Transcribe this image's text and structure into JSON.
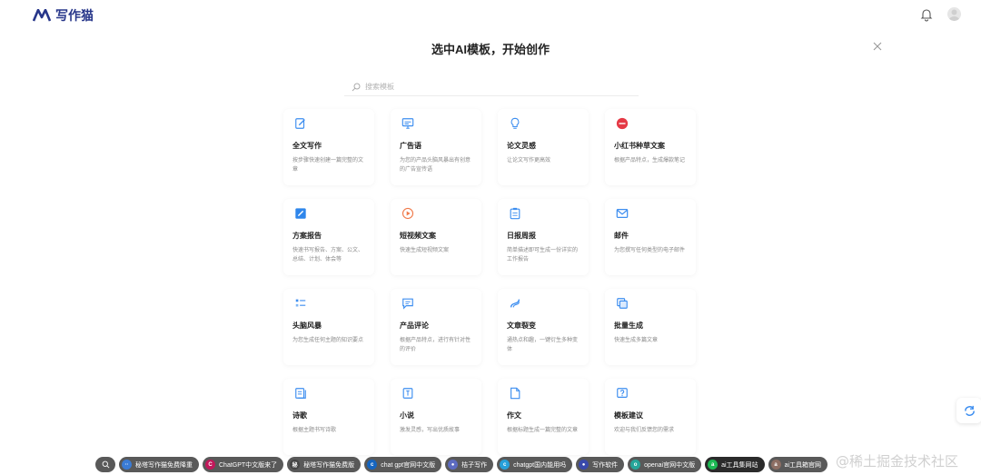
{
  "header": {
    "app_name": "写作猫"
  },
  "title": "选中AI模板，开始创作",
  "search": {
    "placeholder": "搜索模板"
  },
  "cards": [
    {
      "title": "全文写作",
      "desc": "按步骤快速创建一篇完整的文章",
      "icon": "edit-icon"
    },
    {
      "title": "广告语",
      "desc": "为您的产品头脑风暴出有创意的广告宣传语",
      "icon": "monitor-icon"
    },
    {
      "title": "论文灵感",
      "desc": "让论文写作更高效",
      "icon": "lightbulb-icon"
    },
    {
      "title": "小红书种草文案",
      "desc": "根据产品特点，生成爆款笔记",
      "icon": "xiaohongshu-icon"
    },
    {
      "title": "方案报告",
      "desc": "快速书写报告、方案、公文、总结、计划、体会等",
      "icon": "pen-icon"
    },
    {
      "title": "短视频文案",
      "desc": "快速生成短视频文案",
      "icon": "play-icon"
    },
    {
      "title": "日报周报",
      "desc": "简单描述即可生成一份详实的工作报告",
      "icon": "clipboard-icon"
    },
    {
      "title": "邮件",
      "desc": "为您撰写任何类型的电子邮件",
      "icon": "mail-icon"
    },
    {
      "title": "头脑风暴",
      "desc": "为您生成任何主题的知识要点",
      "icon": "list-icon"
    },
    {
      "title": "产品评论",
      "desc": "根据产品特点，进行有针对性的评价",
      "icon": "comment-icon"
    },
    {
      "title": "文章裂变",
      "desc": "通热点和趣，一键衍生多种变体",
      "icon": "split-icon"
    },
    {
      "title": "批量生成",
      "desc": "快速生成多篇文章",
      "icon": "copy-icon"
    },
    {
      "title": "诗歌",
      "desc": "根据主题书写诗歌",
      "icon": "book-icon"
    },
    {
      "title": "小说",
      "desc": "激发灵感，写出优质故事",
      "icon": "novel-icon"
    },
    {
      "title": "作文",
      "desc": "根据标题生成一篇完整的文章",
      "icon": "document-icon"
    },
    {
      "title": "模板建议",
      "desc": "欢迎与我们反馈您的需求",
      "icon": "help-icon"
    }
  ],
  "taskbar": [
    {
      "label": "秘塔写作猫免费降重",
      "color": "#3a7bd5",
      "glyph": "··"
    },
    {
      "label": "ChatGPT中文版来了",
      "color": "#c2185b",
      "glyph": "C"
    },
    {
      "label": "秘塔写作猫免费版",
      "color": "#444444",
      "glyph": "秘"
    },
    {
      "label": "chat gpt官网中文版",
      "color": "#1565c0",
      "glyph": "c"
    },
    {
      "label": "桔子写作",
      "color": "#5c6bc0",
      "glyph": "●"
    },
    {
      "label": "chatgpt国内能用吗",
      "color": "#26a0da",
      "glyph": "c"
    },
    {
      "label": "写作软件",
      "color": "#3949ab",
      "glyph": "●"
    },
    {
      "label": "openai官网中文版",
      "color": "#26a69a",
      "glyph": "o"
    },
    {
      "label": "ai工具集网站",
      "color": "#1b1b1b",
      "glyph": "a"
    },
    {
      "label": "ai工具箱官网",
      "color": "#8d6e63",
      "glyph": "a"
    }
  ],
  "watermark": "@稀土掘金技术社区"
}
